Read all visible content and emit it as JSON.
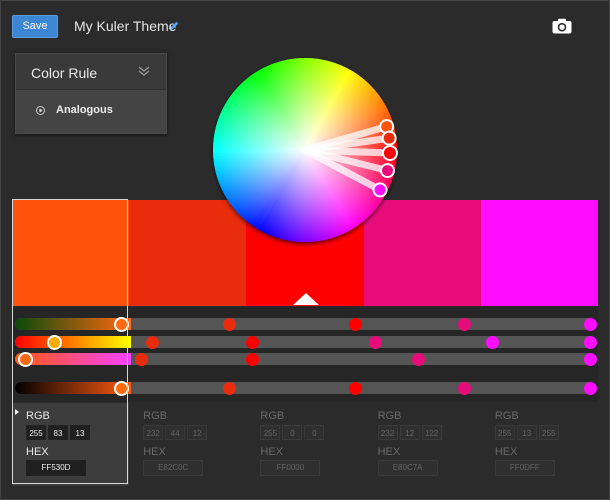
{
  "header": {
    "save_label": "Save",
    "title": "My Kuler Theme",
    "edit_icon": "pencil-icon",
    "camera_icon": "camera-icon"
  },
  "color_rule": {
    "title": "Color Rule",
    "selected": "Analogous"
  },
  "colors": {
    "swatches": [
      "#FF530D",
      "#E82C0C",
      "#FF0000",
      "#E80C7A",
      "#FF0DFF"
    ],
    "active_index": 0
  },
  "values": [
    {
      "rgb_label": "RGB",
      "rgb": [
        "255",
        "83",
        "13"
      ],
      "hex_label": "HEX",
      "hex": "FF530D"
    },
    {
      "rgb_label": "RGB",
      "rgb": [
        "232",
        "44",
        "12"
      ],
      "hex_label": "HEX",
      "hex": "E82C0C"
    },
    {
      "rgb_label": "RGB",
      "rgb": [
        "255",
        "0",
        "0"
      ],
      "hex_label": "HEX",
      "hex": "FF0000"
    },
    {
      "rgb_label": "RGB",
      "rgb": [
        "232",
        "12",
        "122"
      ],
      "hex_label": "HEX",
      "hex": "E80C7A"
    },
    {
      "rgb_label": "RGB",
      "rgb": [
        "255",
        "13",
        "255"
      ],
      "hex_label": "HEX",
      "hex": "FF0DFF"
    }
  ]
}
